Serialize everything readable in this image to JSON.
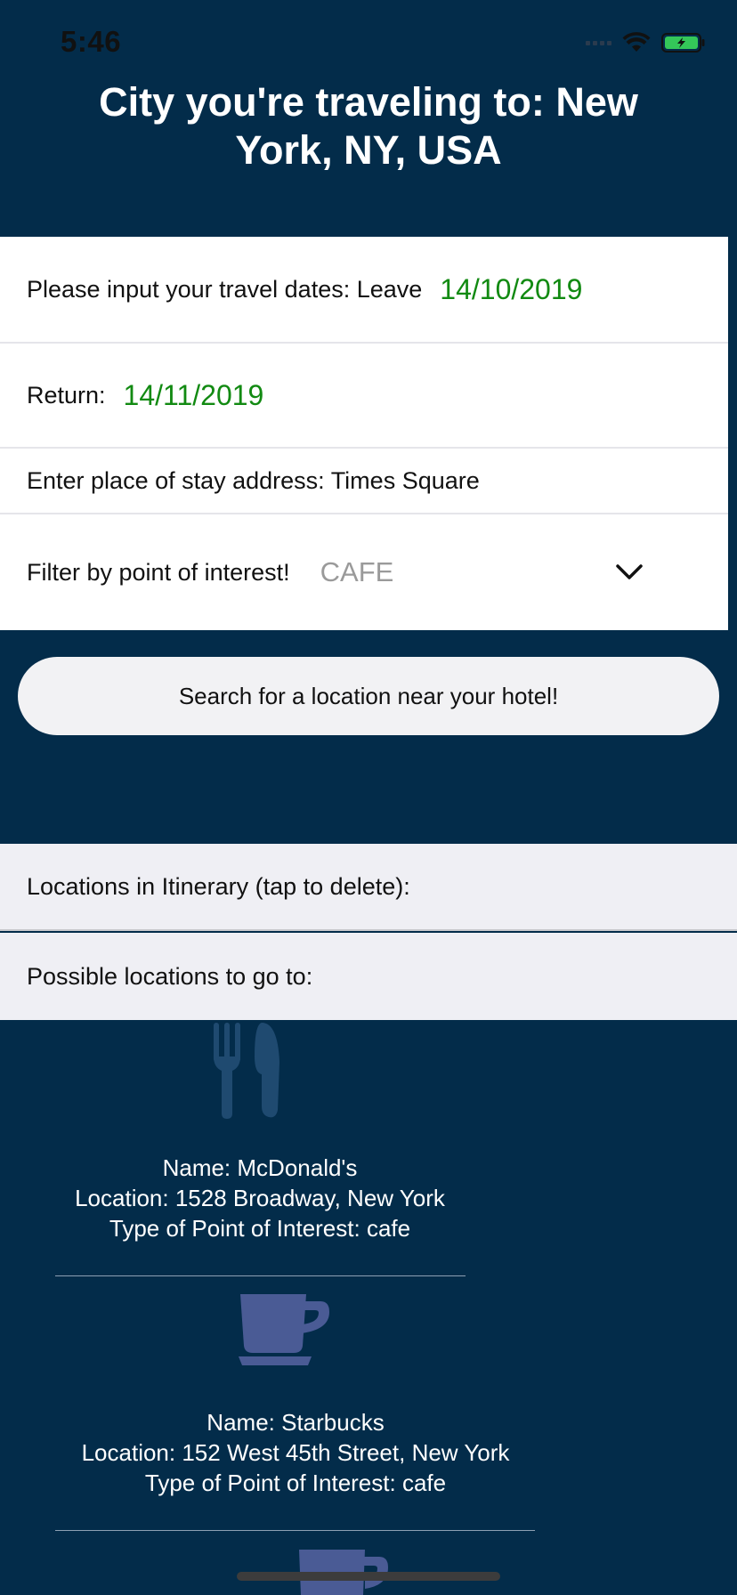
{
  "status_bar": {
    "time": "5:46"
  },
  "header": {
    "title": "City you're traveling to: New York, NY, USA"
  },
  "form": {
    "dates_label": "Please input your travel dates: Leave",
    "leave_date": "14/10/2019",
    "return_label": "Return:",
    "return_date": "14/11/2019",
    "stay_label": "Enter place of stay address: Times Square",
    "filter_label": "Filter by point of interest!",
    "filter_value": "CAFE",
    "search_button_label": "Search for a location near your hotel!"
  },
  "sections": {
    "itinerary_label": "Locations in Itinerary (tap to delete):",
    "possible_label": "Possible locations to go to:"
  },
  "places": [
    {
      "icon": "restaurant-icon",
      "name": "Name: McDonald's",
      "location": "Location: 1528 Broadway, New York",
      "type": "Type of Point of Interest: cafe"
    },
    {
      "icon": "coffee-cup-icon",
      "name": "Name: Starbucks",
      "location": "Location: 152 West 45th Street, New York",
      "type": "Type of Point of Interest: cafe"
    },
    {
      "icon": "coffee-cup-icon"
    }
  ],
  "colors": {
    "background": "#032c4a",
    "date_green": "#128a12",
    "icon_tint": "#4a5b95",
    "section_bg": "#efeff4",
    "battery": "#34c759"
  }
}
